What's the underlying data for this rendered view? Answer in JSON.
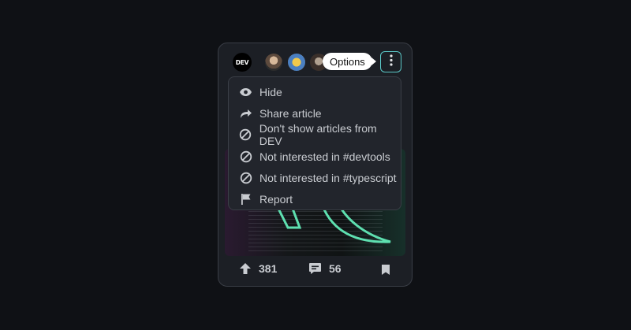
{
  "card": {
    "publisher_logo": "DEV",
    "avatars": [
      "avatar-1",
      "avatar-2",
      "avatar-3"
    ],
    "tooltip": "Options",
    "options_icon": "vertical-dots-icon",
    "accent": "#5bc8c8"
  },
  "menu": {
    "items": [
      {
        "label": "Hide",
        "icon": "eye-icon"
      },
      {
        "label": "Share article",
        "icon": "share-arrow-icon"
      },
      {
        "label": "Don't show articles from DEV",
        "icon": "block-icon"
      },
      {
        "label": "Not interested in #devtools",
        "icon": "block-icon"
      },
      {
        "label": "Not interested in #typescript",
        "icon": "block-icon"
      },
      {
        "label": "Report",
        "icon": "flag-icon"
      }
    ]
  },
  "footer": {
    "upvotes": "381",
    "comments": "56",
    "upvote_icon": "arrow-up-icon",
    "comment_icon": "comment-icon",
    "bookmark_icon": "bookmark-icon"
  }
}
